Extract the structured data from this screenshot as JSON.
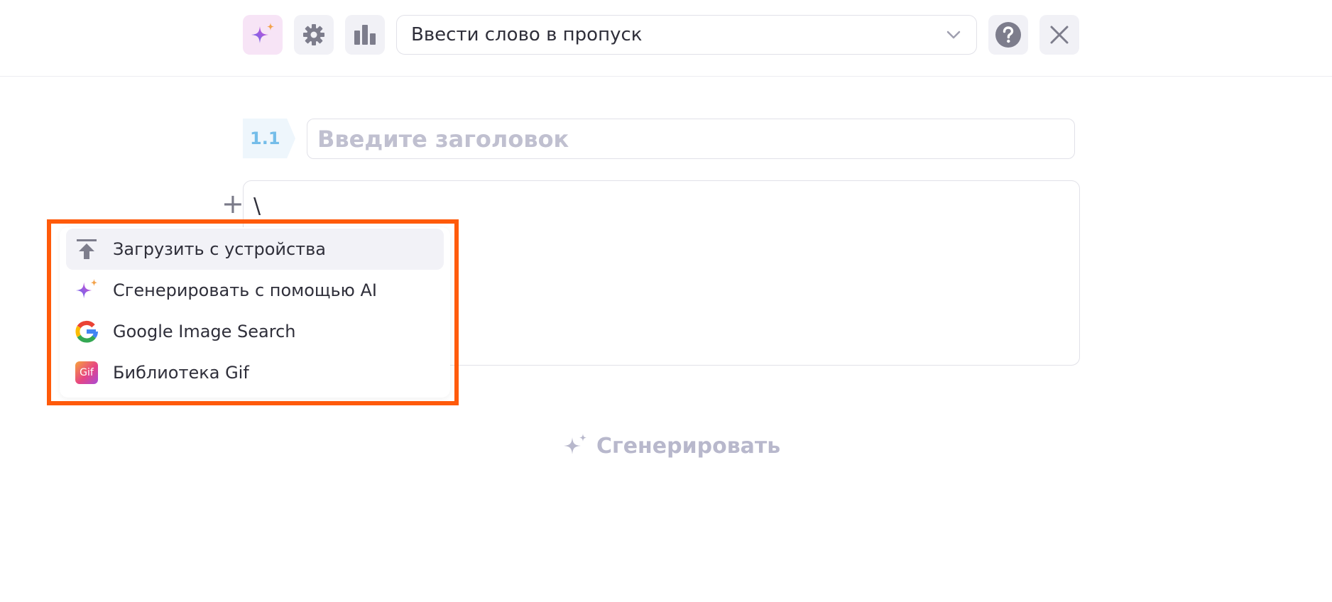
{
  "toolbar": {
    "buttons": [
      {
        "name": "ai-sparkle-icon"
      },
      {
        "name": "gear-icon"
      },
      {
        "name": "bar-chart-icon"
      }
    ],
    "type_select": {
      "value": "Ввести слово в пропуск",
      "icon": "chevron-down-icon"
    },
    "help_icon": "help-icon",
    "close_icon": "close-icon"
  },
  "question": {
    "number": "1.1",
    "title_placeholder": "Введите заголовок",
    "editor_text": "\\"
  },
  "insert_menu": {
    "items": [
      {
        "label": "Загрузить с устройства",
        "icon": "upload-icon"
      },
      {
        "label": "Сгенерировать с помощью AI",
        "icon": "ai-sparkle-icon"
      },
      {
        "label": "Google Image Search",
        "icon": "google-icon"
      },
      {
        "label": "Библиотека Gif",
        "icon": "gif-icon",
        "badge": "Gif"
      }
    ]
  },
  "generate_button": {
    "label": "Сгенерировать"
  },
  "colors": {
    "highlight": "#ff5a0a",
    "accent_light": "#74bde9",
    "muted": "#b8b8cc"
  }
}
